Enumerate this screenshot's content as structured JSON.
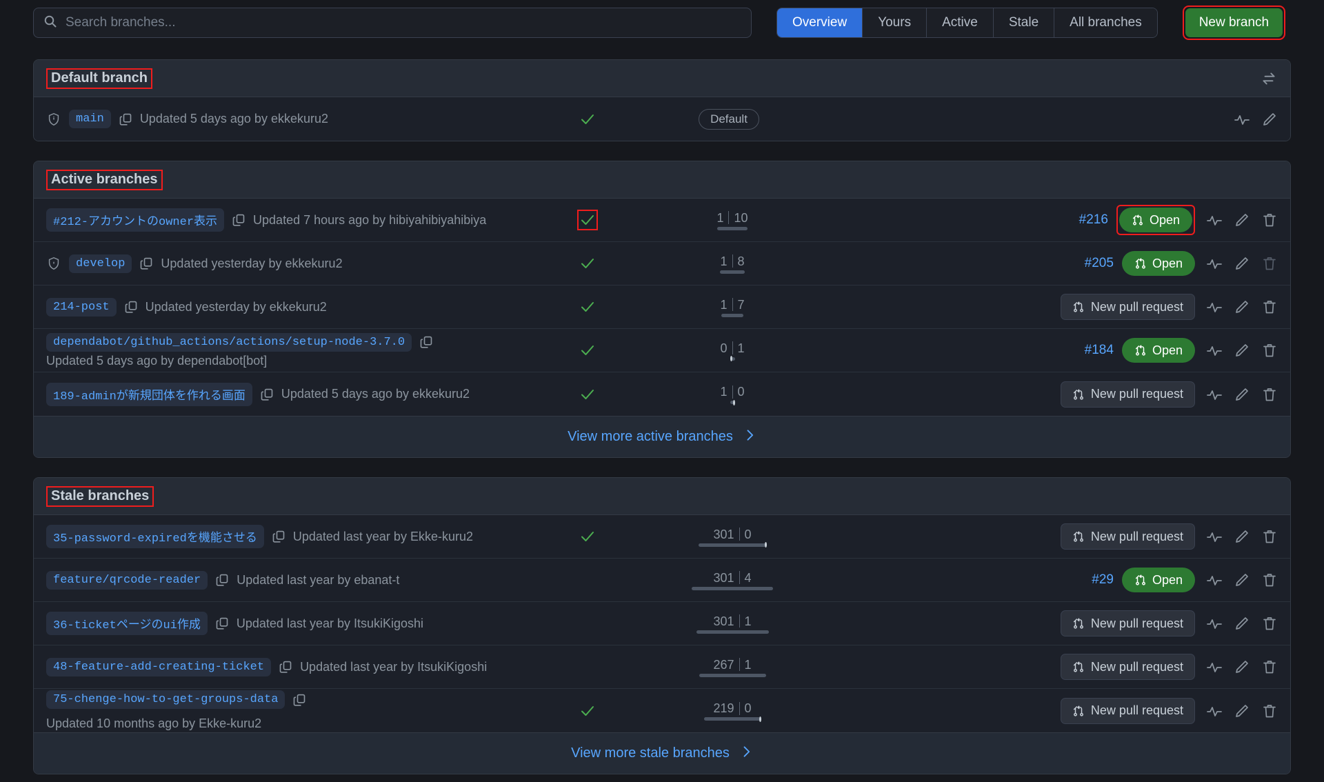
{
  "search": {
    "placeholder": "Search branches...",
    "value": "",
    "icon": "search-icon"
  },
  "tabs": [
    {
      "label": "Overview",
      "active": true
    },
    {
      "label": "Yours",
      "active": false
    },
    {
      "label": "Active",
      "active": false
    },
    {
      "label": "Stale",
      "active": false
    },
    {
      "label": "All branches",
      "active": false
    }
  ],
  "new_branch_button": {
    "label": "New branch",
    "color": "#2d7a32",
    "highlight": "#ef1d1d"
  },
  "default_section": {
    "title": "Default branch",
    "switch_icon": "switch-branches-icon",
    "row": {
      "protected": true,
      "name": "main",
      "copy_icon": "copy-icon",
      "meta": "Updated 5 days ago by ekkekuru2",
      "check": true,
      "badge": "Default",
      "icons": [
        "activity-icon",
        "pencil-icon"
      ]
    }
  },
  "active_section": {
    "title": "Active branches",
    "rows": [
      {
        "protected": false,
        "name": "#212-アカウントのowner表示",
        "meta": "Updated 7 hours ago by hibiyahibiyahibiya",
        "check": true,
        "check_highlighted": true,
        "behind": "1",
        "ahead": "10",
        "behind_w": 4,
        "ahead_w": 40,
        "pr": "#216",
        "action": "Open",
        "action_highlighted": true,
        "trash_enabled": true
      },
      {
        "protected": true,
        "name": "develop",
        "meta": "Updated yesterday by ekkekuru2",
        "check": true,
        "check_highlighted": false,
        "behind": "1",
        "ahead": "8",
        "behind_w": 4,
        "ahead_w": 32,
        "pr": "#205",
        "action": "Open",
        "action_highlighted": false,
        "trash_enabled": false
      },
      {
        "protected": false,
        "name": "214-post",
        "meta": "Updated yesterday by ekkekuru2",
        "check": true,
        "check_highlighted": false,
        "behind": "1",
        "ahead": "7",
        "behind_w": 4,
        "ahead_w": 28,
        "pr": "",
        "action": "New pull request",
        "action_highlighted": false,
        "trash_enabled": true
      },
      {
        "protected": false,
        "stacked": true,
        "name": "dependabot/github_actions/actions/setup-node-3.7.0",
        "meta": "Updated 5 days ago by dependabot[bot]",
        "check": true,
        "check_highlighted": false,
        "behind": "0",
        "ahead": "1",
        "behind_w": 0,
        "ahead_w": 4,
        "pr": "#184",
        "action": "Open",
        "action_highlighted": false,
        "trash_enabled": true
      },
      {
        "protected": false,
        "name": "189-adminが新規団体を作れる画面",
        "meta": "Updated 5 days ago by ekkekuru2",
        "check": true,
        "check_highlighted": false,
        "behind": "1",
        "ahead": "0",
        "behind_w": 4,
        "ahead_w": 0,
        "pr": "",
        "action": "New pull request",
        "action_highlighted": false,
        "trash_enabled": true
      }
    ],
    "view_more": "View more active branches"
  },
  "stale_section": {
    "title": "Stale branches",
    "rows": [
      {
        "protected": false,
        "name": "35-password-expiredを機能させる",
        "meta": "Updated last year by Ekke-kuru2",
        "check": true,
        "check_highlighted": false,
        "behind": "301",
        "ahead": "0",
        "behind_w": 96,
        "ahead_w": 0,
        "pr": "",
        "action": "New pull request",
        "action_highlighted": false,
        "trash_enabled": true
      },
      {
        "protected": false,
        "name": "feature/qrcode-reader",
        "meta": "Updated last year by ebanat-t",
        "check": false,
        "check_highlighted": false,
        "behind": "301",
        "ahead": "4",
        "behind_w": 96,
        "ahead_w": 22,
        "pr": "#29",
        "action": "Open",
        "action_highlighted": false,
        "trash_enabled": true
      },
      {
        "protected": false,
        "name": "36-ticketページのui作成",
        "meta": "Updated last year by ItsukiKigoshi",
        "check": false,
        "check_highlighted": false,
        "behind": "301",
        "ahead": "1",
        "behind_w": 96,
        "ahead_w": 9,
        "pr": "",
        "action": "New pull request",
        "action_highlighted": false,
        "trash_enabled": true
      },
      {
        "protected": false,
        "name": "48-feature-add-creating-ticket",
        "meta": "Updated last year by ItsukiKigoshi",
        "check": false,
        "check_highlighted": false,
        "behind": "267",
        "ahead": "1",
        "behind_w": 88,
        "ahead_w": 9,
        "pr": "",
        "action": "New pull request",
        "action_highlighted": false,
        "trash_enabled": true
      },
      {
        "protected": false,
        "name": "75-chenge-how-to-get-groups-data",
        "meta": "Updated 10 months ago by Ekke-kuru2",
        "check": true,
        "check_highlighted": false,
        "behind": "219",
        "ahead": "0",
        "behind_w": 80,
        "ahead_w": 0,
        "pr": "",
        "action": "New pull request",
        "action_highlighted": false,
        "trash_enabled": true
      }
    ],
    "view_more": "View more stale branches"
  }
}
